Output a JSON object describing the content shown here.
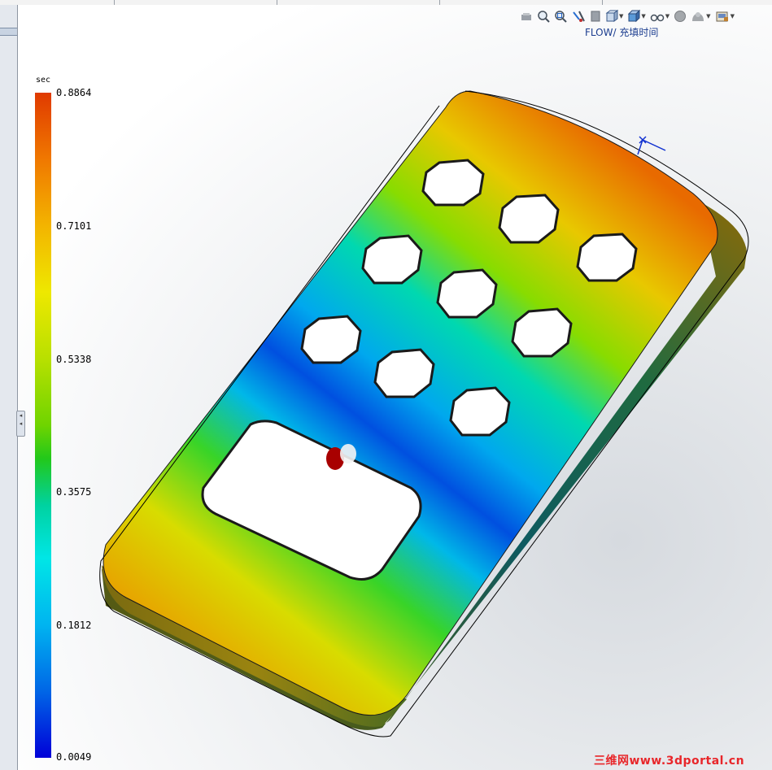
{
  "toolbar": {
    "study_label": "FLOW/ 充填时间",
    "buttons": [
      {
        "icon": "previous-view-icon"
      },
      {
        "icon": "zoom-to-fit-icon"
      },
      {
        "icon": "zoom-to-area-icon"
      },
      {
        "icon": "section-view-icon"
      },
      {
        "icon": "dynamic-annotation-icon"
      },
      {
        "icon": "view-orientation-icon",
        "dropdown": true
      },
      {
        "icon": "display-style-icon",
        "dropdown": true
      },
      {
        "icon": "hide-show-items-icon",
        "dropdown": true
      },
      {
        "icon": "edit-appearance-icon"
      },
      {
        "icon": "apply-scene-icon",
        "dropdown": true
      },
      {
        "icon": "view-settings-icon",
        "dropdown": true
      }
    ]
  },
  "legend": {
    "unit": "sec",
    "labels": [
      "0.8864",
      "0.7101",
      "0.5338",
      "0.3575",
      "0.1812",
      "0.0049"
    ],
    "colors": {
      "max": "#e03a00",
      "mid": "#22c81a",
      "min": "#0000d8"
    }
  },
  "watermark": "三维网www.3dportal.cn"
}
